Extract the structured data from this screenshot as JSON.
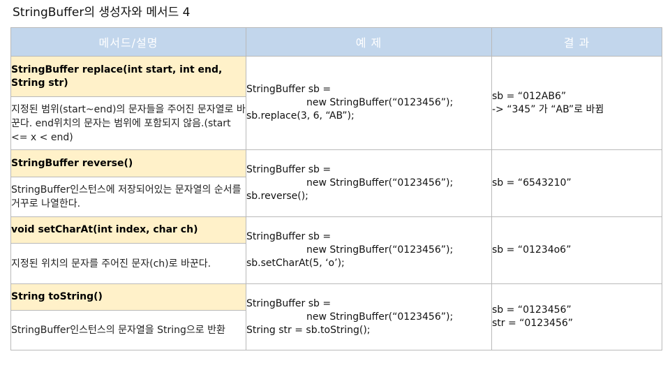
{
  "page_title": "StringBuffer의 생성자와 메서드 4",
  "table": {
    "headers": {
      "method": "메서드/설명",
      "example": "예 제",
      "result": "결 과"
    },
    "rows": [
      {
        "method": "StringBuffer replace(int start, int end, String str)",
        "desc": " 지정된 범위(start~end)의 문자들을 주어진 문자열로 바꾼다. end위치의 문자는 범위에 포함되지 않음.(start <= x < end)",
        "example": [
          "StringBuffer sb =",
          "new StringBuffer(“0123456”);",
          "sb.replace(3, 6, “AB”);"
        ],
        "result": [
          "sb = “012AB6”",
          "-> “345” 가 “AB”로 바뀜"
        ]
      },
      {
        "method": "StringBuffer reverse()",
        "desc": " StringBuffer인스턴스에 저장되어있는 문자열의 순서를 거꾸로 나열한다.",
        "example": [
          "StringBuffer sb =",
          "new StringBuffer(“0123456”);",
          "sb.reverse();"
        ],
        "result": [
          "sb = “6543210”"
        ]
      },
      {
        "method": "void setCharAt(int index, char ch)",
        "desc": " 지정된 위치의 문자를 주어진 문자(ch)로 바꾼다.",
        "example": [
          "StringBuffer sb =",
          "new StringBuffer(“0123456”);",
          "sb.setCharAt(5, ‘o’);"
        ],
        "result": [
          "sb = “01234o6”"
        ]
      },
      {
        "method": "String toString()",
        "desc": " StringBuffer인스턴스의 문자열을 String으로 반환",
        "example": [
          "StringBuffer sb =",
          "new StringBuffer(“0123456”);",
          "String str = sb.toString();"
        ],
        "result": [
          "sb = “0123456”",
          "str = “0123456”"
        ]
      }
    ]
  }
}
